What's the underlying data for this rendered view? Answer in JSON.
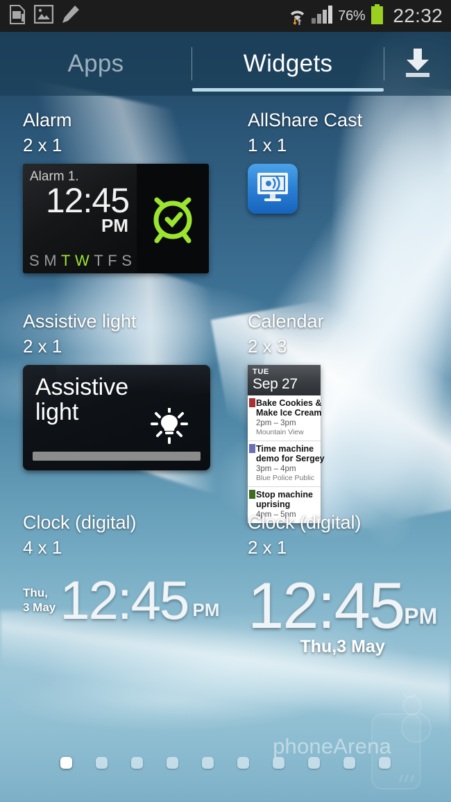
{
  "status_bar": {
    "icons_left": [
      "sd-card-icon",
      "gallery-image-icon",
      "pencil-edit-icon"
    ],
    "wifi_icon": "wifi-transfer-icon",
    "signal_icon": "cellular-signal-icon",
    "battery_percent": "76%",
    "battery_icon": "battery-full-icon",
    "clock": "22:32"
  },
  "tabs": {
    "apps_label": "Apps",
    "widgets_label": "Widgets",
    "active": "Widgets",
    "download_icon": "download-icon"
  },
  "widgets": [
    {
      "name": "Alarm",
      "size": "2 x 1",
      "preview": {
        "type": "alarm",
        "label": "Alarm 1.",
        "time": "12:45",
        "ampm": "PM",
        "days": [
          "S",
          "M",
          "T",
          "W",
          "T",
          "F",
          "S"
        ],
        "days_active": [
          false,
          false,
          true,
          true,
          false,
          false,
          false
        ],
        "accent_color": "#9ce52f",
        "icon": "alarm-clock-icon"
      }
    },
    {
      "name": "AllShare Cast",
      "size": "1 x 1",
      "preview": {
        "type": "icon",
        "icon": "allshare-cast-icon",
        "icon_color": "#2a7fd4"
      }
    },
    {
      "name": "Assistive light",
      "size": "2 x 1",
      "preview": {
        "type": "assistive-light",
        "line1": "Assistive",
        "line2": "light",
        "icon": "light-bulb-icon"
      }
    },
    {
      "name": "Calendar",
      "size": "2 x 3",
      "preview": {
        "type": "calendar",
        "day_of_week": "TUE",
        "date": "Sep 27",
        "events": [
          {
            "title_line1": "Bake Cookies &",
            "title_line2": "Make Ice Cream",
            "time": "2pm – 3pm",
            "location": "Mountain View",
            "color": "#a83232"
          },
          {
            "title_line1": "Time machine",
            "title_line2": "demo for Sergey",
            "time": "3pm – 4pm",
            "location": "Blue Police Public",
            "color": "#6b6fb5"
          },
          {
            "title_line1": "Stop machine",
            "title_line2": "uprising",
            "time": "4pm – 5pm",
            "location": "",
            "color": "#3f6b1f"
          }
        ]
      }
    },
    {
      "name": "Clock (digital)",
      "size": "4 x 1",
      "preview": {
        "type": "clock-4x1",
        "date_line1": "Thu,",
        "date_line2": "3 May",
        "time": "12:45",
        "ampm": "PM"
      }
    },
    {
      "name": "Clock (digital)",
      "size": "2 x 1",
      "preview": {
        "type": "clock-2x1",
        "time": "12:45",
        "ampm": "PM",
        "date": "Thu,3 May"
      }
    }
  ],
  "pager": {
    "total_pages": 10,
    "current_page": 1
  },
  "watermark": {
    "text": "phoneArena",
    "logo": "phonearena-logo"
  },
  "colors": {
    "accent_green": "#9ce52f",
    "tab_underline": "#b9d8ea",
    "status_bar_bg": "#1c1c1c"
  }
}
